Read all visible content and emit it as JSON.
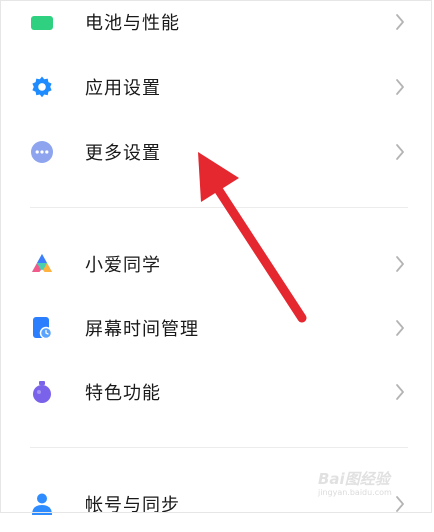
{
  "settings": {
    "items": [
      {
        "label": "电池与性能",
        "icon": "battery-icon",
        "color": "#2fd181"
      },
      {
        "label": "应用设置",
        "icon": "gear-icon",
        "color": "#1e8cff"
      },
      {
        "label": "更多设置",
        "icon": "more-dots-icon",
        "color": "#8ea4ef"
      },
      {
        "label": "小爱同学",
        "icon": "xiaoai-icon",
        "color": "#4ad0b0"
      },
      {
        "label": "屏幕时间管理",
        "icon": "screen-time-icon",
        "color": "#2b7fff"
      },
      {
        "label": "特色功能",
        "icon": "feature-flask-icon",
        "color": "#7a62ea"
      },
      {
        "label": "帐号与同步",
        "icon": "account-icon",
        "color": "#2f8cff"
      }
    ]
  },
  "watermark": {
    "brand": "Bai图经验",
    "sub": "jingyan.baidu.com"
  },
  "colors": {
    "arrow": "#e5272f",
    "chevron": "#b4b4b4"
  }
}
